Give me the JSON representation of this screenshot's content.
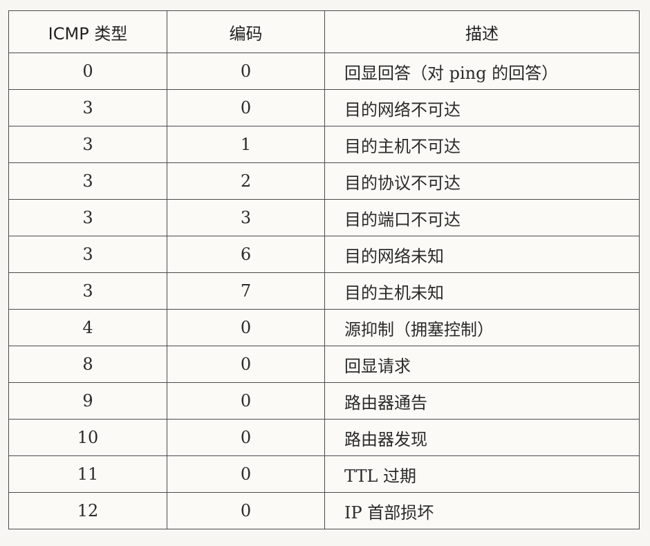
{
  "table": {
    "headers": [
      "ICMP 类型",
      "编码",
      "描述"
    ],
    "rows": [
      [
        "0",
        "0",
        "回显回答（对 ping 的回答）"
      ],
      [
        "3",
        "0",
        "目的网络不可达"
      ],
      [
        "3",
        "1",
        "目的主机不可达"
      ],
      [
        "3",
        "2",
        "目的协议不可达"
      ],
      [
        "3",
        "3",
        "目的端口不可达"
      ],
      [
        "3",
        "6",
        "目的网络未知"
      ],
      [
        "3",
        "7",
        "目的主机未知"
      ],
      [
        "4",
        "0",
        "源抑制（拥塞控制）"
      ],
      [
        "8",
        "0",
        "回显请求"
      ],
      [
        "9",
        "0",
        "路由器通告"
      ],
      [
        "10",
        "0",
        "路由器发现"
      ],
      [
        "11",
        "0",
        "TTL 过期"
      ],
      [
        "12",
        "0",
        "IP 首部损坏"
      ]
    ]
  }
}
